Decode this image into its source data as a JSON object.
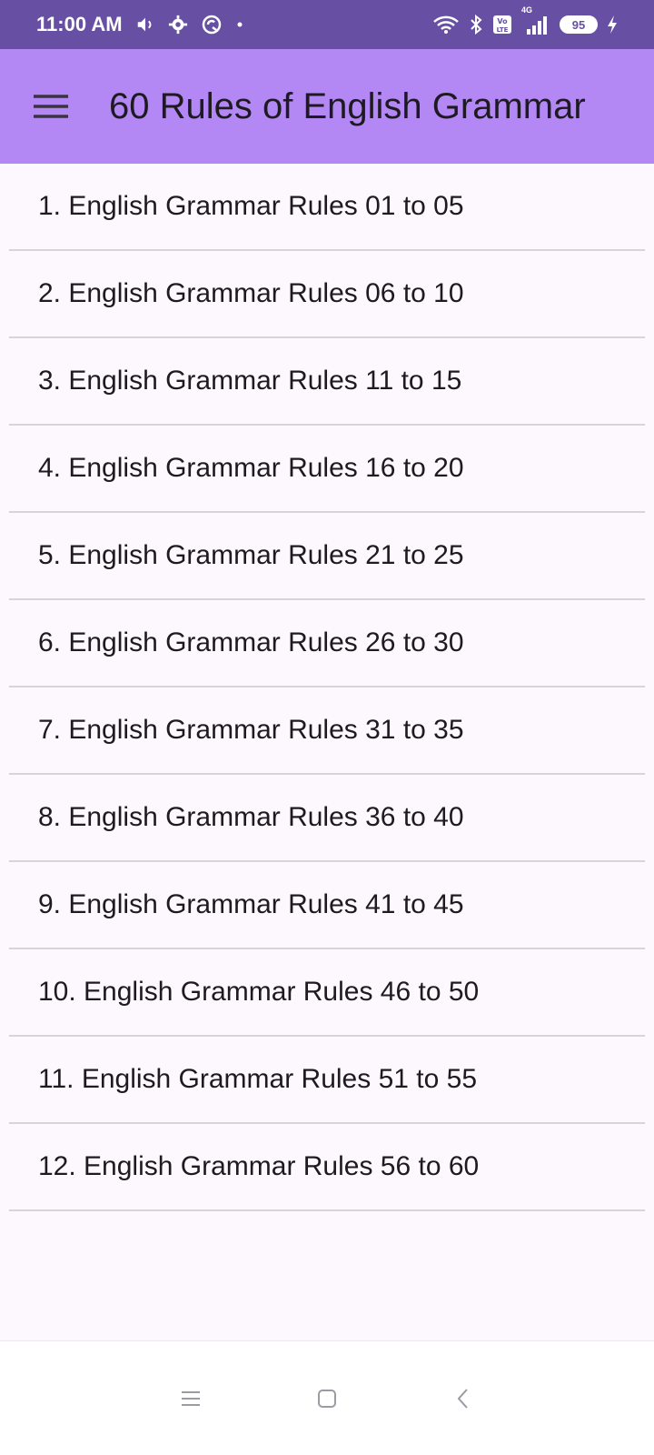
{
  "status_bar": {
    "time": "11:00 AM",
    "battery": "95",
    "network": "4G",
    "icons_left": [
      "volume-icon",
      "gear-icon",
      "sync-icon",
      "dot-icon"
    ],
    "icons_right": [
      "wifi-icon",
      "bluetooth-icon",
      "volte-icon",
      "signal-icon",
      "battery-icon",
      "charging-icon"
    ]
  },
  "app_bar": {
    "title": "60 Rules of English Grammar",
    "menu_icon": "hamburger-menu-icon"
  },
  "list": {
    "items": [
      {
        "label": "1. English Grammar Rules 01 to 05"
      },
      {
        "label": "2. English Grammar Rules 06 to 10"
      },
      {
        "label": "3. English Grammar Rules 11 to 15"
      },
      {
        "label": "4. English Grammar Rules 16 to 20"
      },
      {
        "label": "5. English Grammar Rules 21 to 25"
      },
      {
        "label": "6. English Grammar Rules 26 to 30"
      },
      {
        "label": "7. English Grammar Rules 31 to 35"
      },
      {
        "label": "8. English Grammar Rules 36 to 40"
      },
      {
        "label": "9. English Grammar Rules 41 to 45"
      },
      {
        "label": "10. English Grammar Rules 46 to 50"
      },
      {
        "label": "11. English Grammar Rules 51 to 55"
      },
      {
        "label": "12. English Grammar Rules 56 to 60"
      }
    ]
  },
  "nav_bar": {
    "buttons": [
      "recent-apps-icon",
      "home-icon",
      "back-icon"
    ]
  },
  "colors": {
    "status_bar": "#6750a4",
    "app_bar": "#b388f5",
    "background": "#fdf8fd",
    "divider": "#d8d4dc",
    "text": "#1d1b20"
  }
}
